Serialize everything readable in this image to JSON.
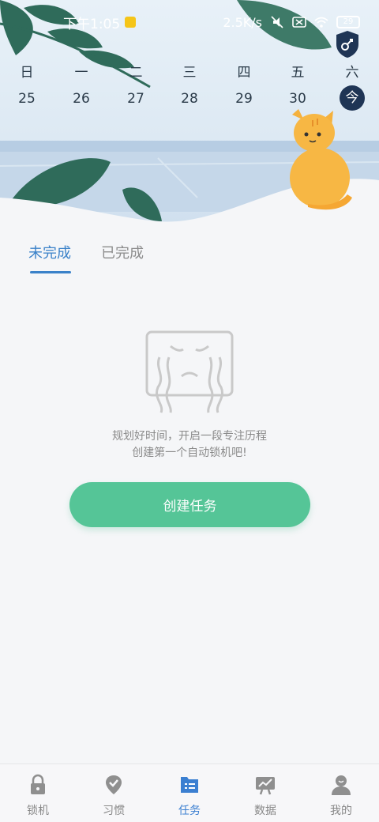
{
  "status_bar": {
    "time": "下午1:05",
    "network_speed": "2.5K/s",
    "battery": "29"
  },
  "week": {
    "days": [
      {
        "weekday": "日",
        "date": "25"
      },
      {
        "weekday": "一",
        "date": "26"
      },
      {
        "weekday": "二",
        "date": "27"
      },
      {
        "weekday": "三",
        "date": "28"
      },
      {
        "weekday": "四",
        "date": "29"
      },
      {
        "weekday": "五",
        "date": "30"
      },
      {
        "weekday": "六",
        "date": "今"
      }
    ],
    "today_index": 6
  },
  "tabs": [
    {
      "label": "未完成",
      "active": true
    },
    {
      "label": "已完成",
      "active": false
    }
  ],
  "empty_state": {
    "line1": "规划好时间，开启一段专注历程",
    "line2": "创建第一个自动锁机吧!",
    "button_label": "创建任务"
  },
  "bottom_nav": [
    {
      "label": "锁机",
      "icon": "lock-icon",
      "active": false
    },
    {
      "label": "习惯",
      "icon": "location-check-icon",
      "active": false
    },
    {
      "label": "任务",
      "icon": "task-list-icon",
      "active": true
    },
    {
      "label": "数据",
      "icon": "chart-board-icon",
      "active": false
    },
    {
      "label": "我的",
      "icon": "profile-icon",
      "active": false
    }
  ],
  "colors": {
    "accent": "#3b82c9",
    "button": "#55c597",
    "today_badge": "#1f3555"
  }
}
